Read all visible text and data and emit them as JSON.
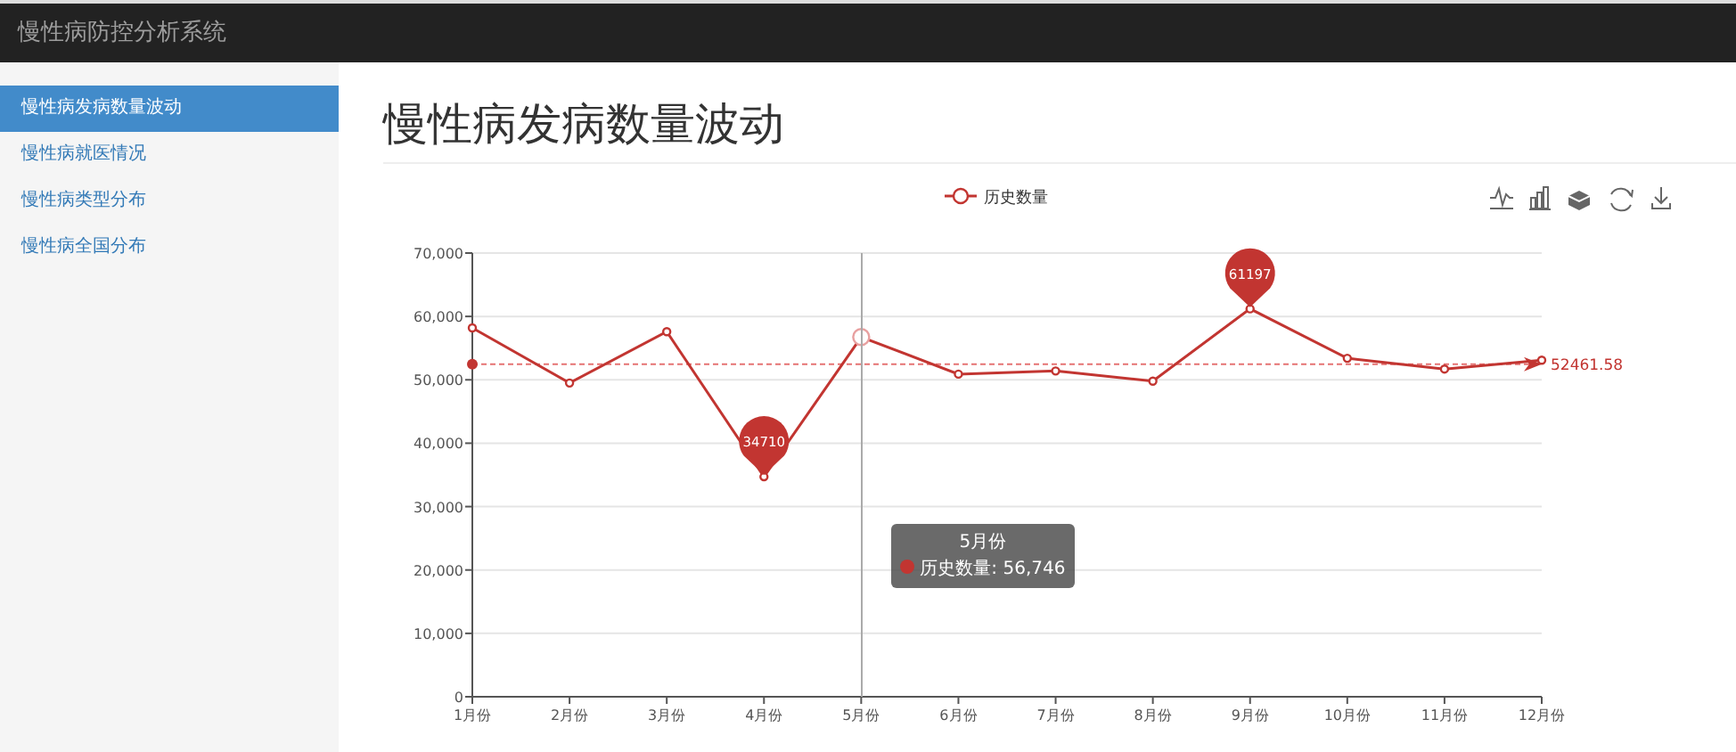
{
  "navbar": {
    "brand": "慢性病防控分析系统"
  },
  "sidebar": {
    "items": [
      {
        "label": "慢性病发病数量波动",
        "selected": true
      },
      {
        "label": "慢性病就医情况",
        "selected": false
      },
      {
        "label": "慢性病类型分布",
        "selected": false
      },
      {
        "label": "慢性病全国分布",
        "selected": false
      }
    ]
  },
  "page_title": "慢性病发病数量波动",
  "chart": {
    "chart_data": {
      "type": "line",
      "categories": [
        "1月份",
        "2月份",
        "3月份",
        "4月份",
        "5月份",
        "6月份",
        "7月份",
        "8月份",
        "9月份",
        "10月份",
        "11月份",
        "12月份"
      ],
      "series": [
        {
          "name": "历史数量",
          "color": "#c23531",
          "marker": "o",
          "values": [
            58200,
            49500,
            57600,
            34710,
            56746,
            50900,
            51400,
            49800,
            61197,
            53400,
            51700,
            53100
          ]
        }
      ],
      "grid": true,
      "ylim": [
        0,
        70000
      ],
      "yticks": [
        {
          "value": 0,
          "label": "0"
        },
        {
          "value": 10000,
          "label": "10,000"
        },
        {
          "value": 20000,
          "label": "20,000"
        },
        {
          "value": 30000,
          "label": "30,000"
        },
        {
          "value": 40000,
          "label": "40,000"
        },
        {
          "value": 50000,
          "label": "50,000"
        },
        {
          "value": 60000,
          "label": "60,000"
        },
        {
          "value": 70000,
          "label": "70,000"
        }
      ],
      "annotations": [
        {
          "x": "9月份",
          "y": 61197,
          "text": "61197"
        },
        {
          "x": "4月份",
          "y": 34710,
          "text": "34710"
        }
      ],
      "ref_lines": [
        {
          "axis": "y",
          "value": 52461.58,
          "label": "52461.58"
        }
      ]
    },
    "tooltip": {
      "title": "5月份",
      "text": "历史数量: 56,746",
      "color": "#c23531"
    }
  }
}
